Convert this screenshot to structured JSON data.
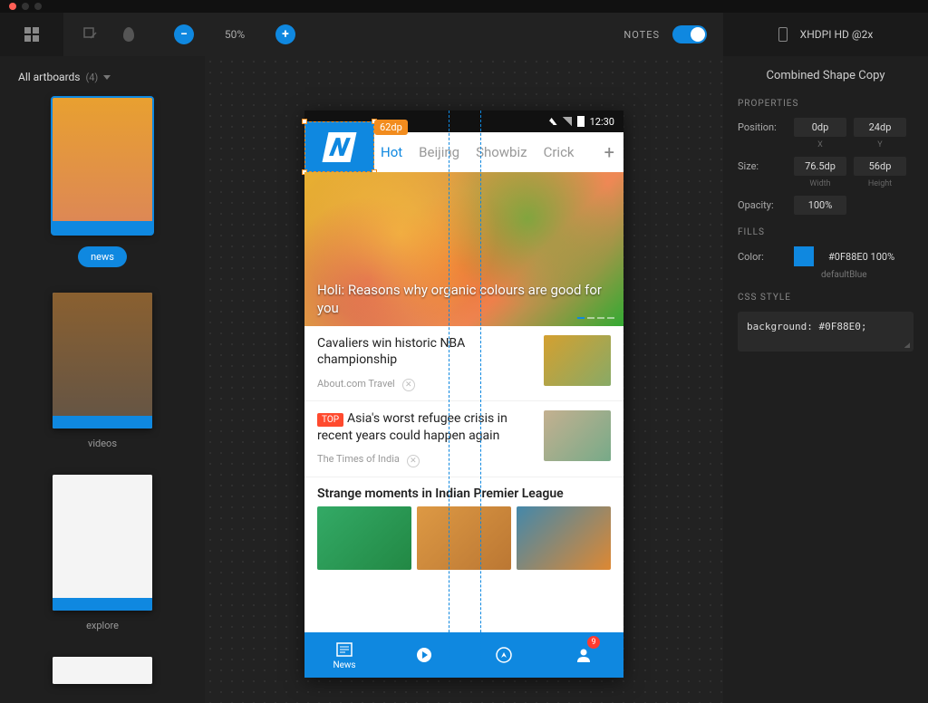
{
  "toolbar": {
    "zoom": "50%",
    "notes_label": "NOTES",
    "device_label": "XHDPI HD @2x"
  },
  "sidebar": {
    "header": "All artboards",
    "count": "(4)",
    "artboards": [
      {
        "label": "news"
      },
      {
        "label": "videos"
      },
      {
        "label": "explore"
      },
      {
        "label": ""
      }
    ]
  },
  "phone": {
    "statusbar": {
      "time": "12:30"
    },
    "measurement": "62dp",
    "tabs": [
      "Hot",
      "Beijing",
      "Showbiz",
      "Crick"
    ],
    "hero_title": "Holi: Reasons why organic colours are good for you",
    "rows": [
      {
        "title": "Cavaliers win historic NBA championship",
        "source": "About.com Travel"
      },
      {
        "badge": "TOP",
        "title": "Asia's worst refugee crisis in recent years could happen again",
        "source": "The Times of India"
      }
    ],
    "section_title": "Strange moments in Indian Premier League",
    "bottom_nav": {
      "news": "News",
      "badge": "9"
    }
  },
  "inspector": {
    "title": "Combined Shape Copy",
    "sections": {
      "properties": "PROPERTIES",
      "fills": "FILLS",
      "css": "CSS STYLE"
    },
    "labels": {
      "position": "Position:",
      "size": "Size:",
      "opacity": "Opacity:",
      "color": "Color:",
      "x": "X",
      "y": "Y",
      "width": "Width",
      "height": "Height"
    },
    "position": {
      "x": "0dp",
      "y": "24dp"
    },
    "size": {
      "w": "76.5dp",
      "h": "56dp"
    },
    "opacity": "100%",
    "fill": {
      "value": "#0F88E0 100%",
      "name": "defaultBlue"
    },
    "css": "background: #0F88E0;"
  }
}
